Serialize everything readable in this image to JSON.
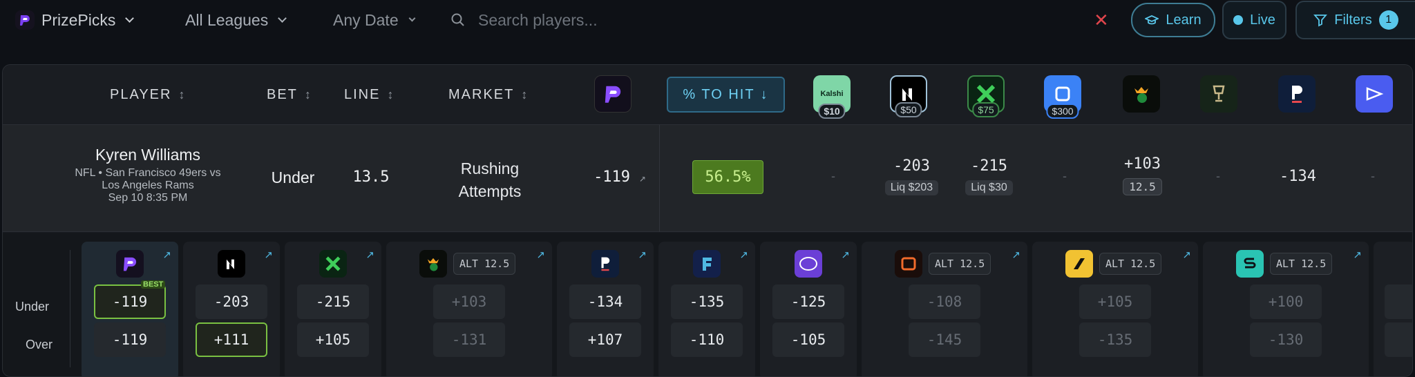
{
  "topbar": {
    "app": "PrizePicks",
    "leagues": "All Leagues",
    "date": "Any Date",
    "search_placeholder": "Search players...",
    "learn": "Learn",
    "live": "Live",
    "filters": "Filters",
    "filter_count": "1"
  },
  "header": {
    "player": "PLAYER",
    "bet": "BET",
    "line": "LINE",
    "market": "MARKET",
    "hit": "% TO HIT",
    "sort_icon": "↕",
    "hit_sort_icon": "↓",
    "bonuses": [
      "$10",
      "$50",
      "$75",
      "$300"
    ],
    "kalshi": "Kalshi"
  },
  "row": {
    "name": "Kyren Williams",
    "sub1": "NFL • San Francisco 49ers vs",
    "sub2": "Los Angeles Rams",
    "time": "Sep 10 8:35 PM",
    "bet": "Under",
    "line": "13.5",
    "market1": "Rushing",
    "market2": "Attempts",
    "odds": "-119",
    "hit": "56.5%",
    "b1": "-203",
    "b1liq": "Liq $203",
    "b2": "-215",
    "b2liq": "Liq $30",
    "b3": "+103",
    "b3alt": "12.5",
    "b4": "-134",
    "dash": "-"
  },
  "cards": {
    "under": "Under",
    "over": "Over",
    "best": "BEST",
    "alt": "ALT 12.5",
    "books": [
      {
        "u": "-119",
        "o": "-119"
      },
      {
        "u": "-203",
        "o": "+111"
      },
      {
        "u": "-215",
        "o": "+105"
      },
      {
        "u": "+103",
        "o": "-131"
      },
      {
        "u": "-134",
        "o": "+107"
      },
      {
        "u": "-135",
        "o": "-110"
      },
      {
        "u": "-125",
        "o": "-105"
      },
      {
        "u": "-108",
        "o": "-145"
      },
      {
        "u": "+105",
        "o": "-135"
      },
      {
        "u": "+100",
        "o": "-130"
      }
    ]
  },
  "colors": {
    "accent": "#59c7ea",
    "best_green": "#7ac142",
    "hit_bg": "#4c7a1f"
  },
  "icons": [
    "prizepicks-icon",
    "search-icon",
    "close-icon",
    "cap-icon",
    "filter-icon",
    "sort-icon",
    "external-link-icon"
  ]
}
